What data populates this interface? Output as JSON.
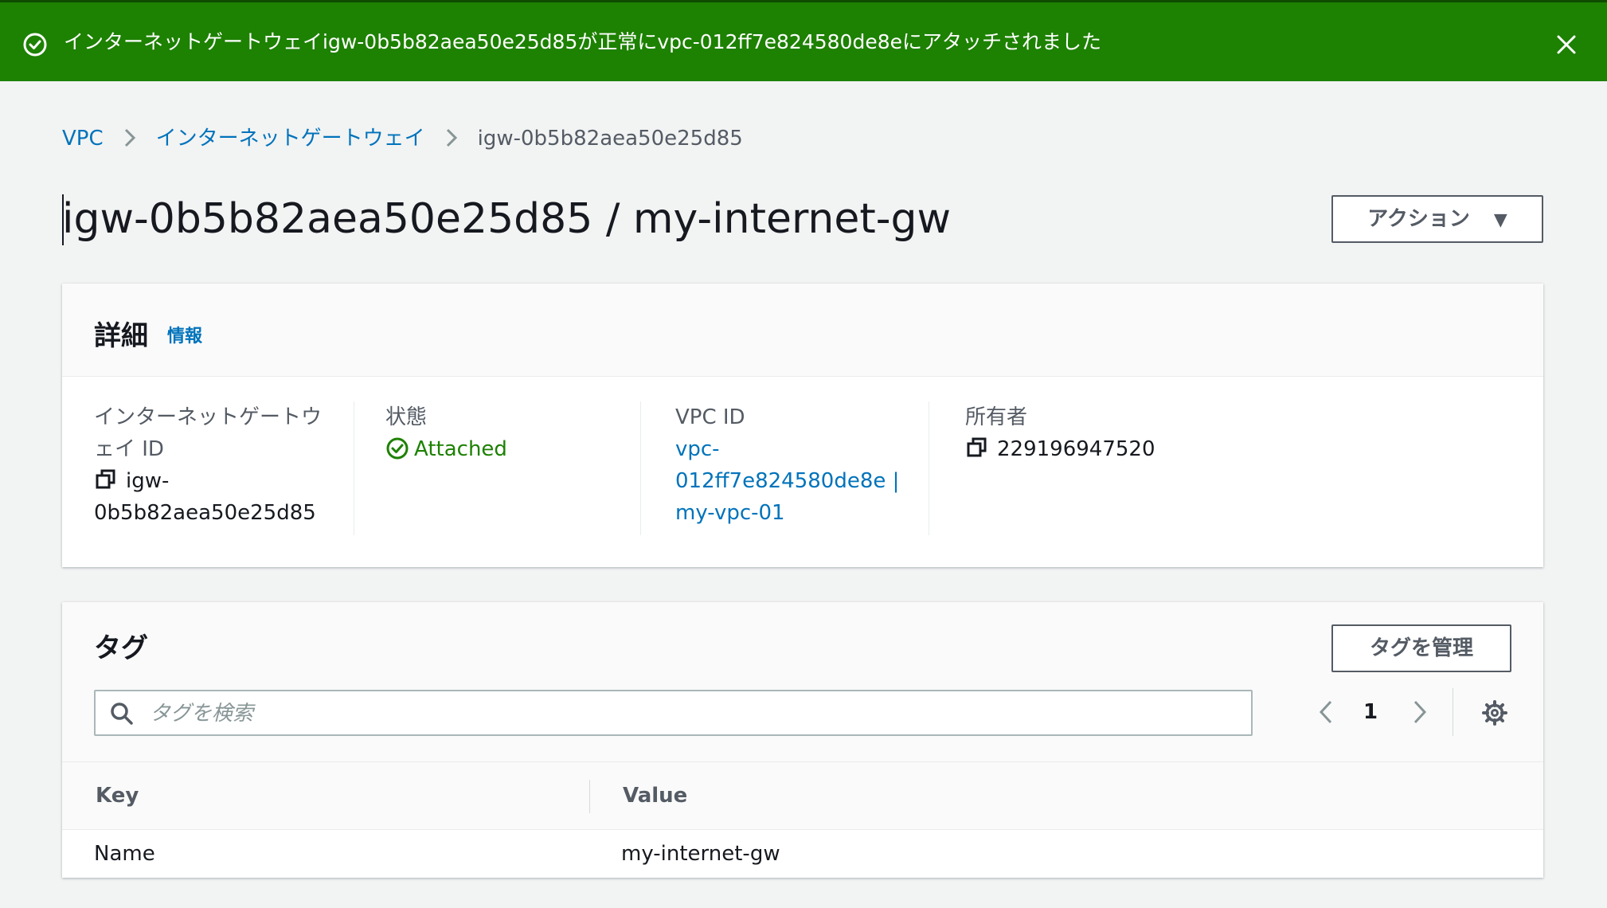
{
  "banner": {
    "message": "インターネットゲートウェイigw-0b5b82aea50e25d85が正常にvpc-012ff7e824580de8eにアタッチされました",
    "color": "#1d8102"
  },
  "breadcrumb": {
    "items": [
      "VPC",
      "インターネットゲートウェイ"
    ],
    "current": "igw-0b5b82aea50e25d85"
  },
  "page": {
    "title": "igw-0b5b82aea50e25d85 / my-internet-gw",
    "actions_label": "アクション"
  },
  "details": {
    "title": "詳細",
    "info_link": "情報",
    "igw_id_label": "インターネットゲートウェイ ID",
    "igw_id_value": "igw-0b5b82aea50e25d85",
    "state_label": "状態",
    "state_value": "Attached",
    "vpc_id_label": "VPC ID",
    "vpc_id_line1": "vpc-012ff7e824580de8e |",
    "vpc_id_line2": "my-vpc-01",
    "owner_label": "所有者",
    "owner_value": "229196947520"
  },
  "tags": {
    "title": "タグ",
    "manage_label": "タグを管理",
    "search_placeholder": "タグを検索",
    "page_number": "1",
    "columns": [
      "Key",
      "Value"
    ],
    "rows": [
      {
        "key": "Name",
        "value": "my-internet-gw"
      }
    ]
  },
  "colors": {
    "link": "#0073bb",
    "success": "#1d8102"
  }
}
